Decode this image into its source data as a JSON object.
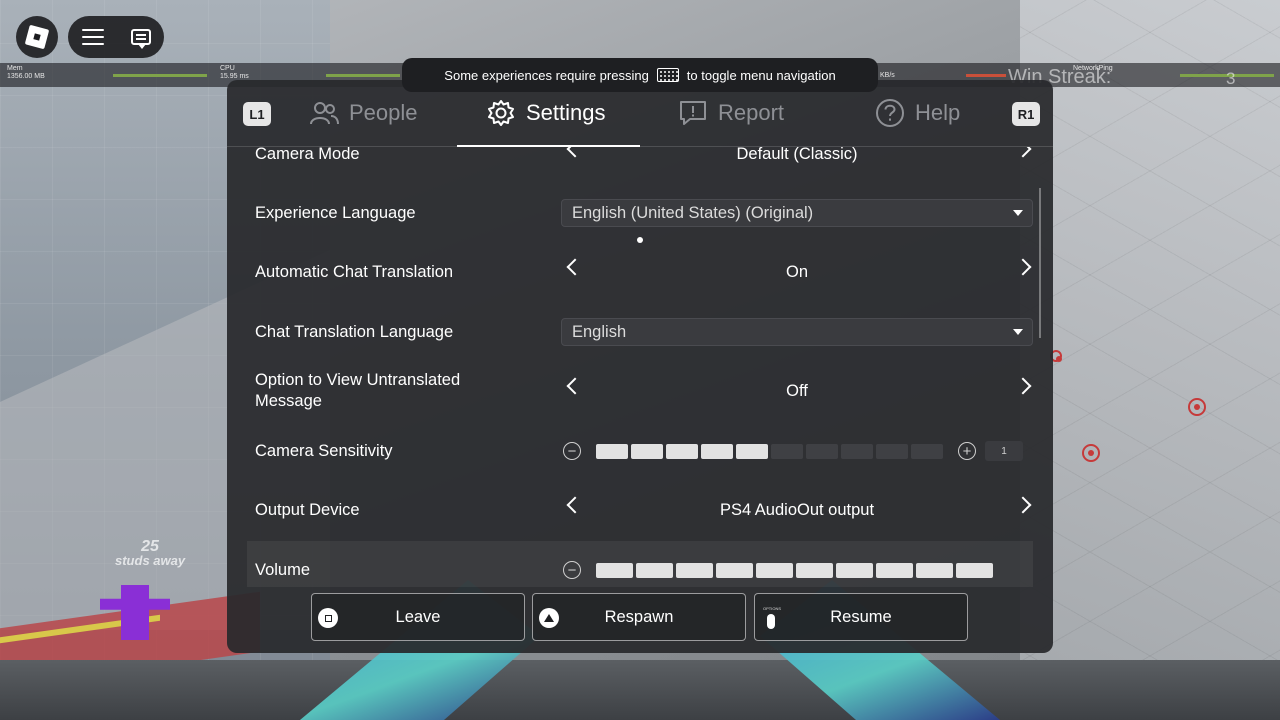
{
  "toast": {
    "text_before": "Some experiences require pressing",
    "text_after": "to toggle menu navigation"
  },
  "stats": {
    "mem_label": "Mem",
    "mem_value": "1356.00 MB",
    "cpu_label": "CPU",
    "cpu_value": "15.95 ms",
    "net_unit": "KB/s",
    "ping_label": "NetworkPing"
  },
  "game": {
    "win_streak_label": "Win Streak:",
    "win_streak_value": "3",
    "studs_number": "25",
    "studs_text": "studs away"
  },
  "shoulders": {
    "left": "L1",
    "right": "R1"
  },
  "tabs": [
    {
      "label": "People",
      "icon": "people-icon"
    },
    {
      "label": "Settings",
      "icon": "gear-icon"
    },
    {
      "label": "Report",
      "icon": "report-icon"
    },
    {
      "label": "Help",
      "icon": "help-icon"
    }
  ],
  "settings": {
    "camera_mode": {
      "label": "Camera Mode",
      "value": "Default (Classic)"
    },
    "experience_language": {
      "label": "Experience Language",
      "value": "English (United States) (Original)"
    },
    "auto_chat_translation": {
      "label": "Automatic Chat Translation",
      "value": "On"
    },
    "chat_translation_language": {
      "label": "Chat Translation Language",
      "value": "English"
    },
    "untranslated_message": {
      "label": "Option to View Untranslated Message",
      "value": "Off"
    },
    "camera_sensitivity": {
      "label": "Camera Sensitivity",
      "level": 5,
      "segments": 10,
      "value": "1"
    },
    "output_device": {
      "label": "Output Device",
      "value": "PS4 AudioOut output"
    },
    "volume": {
      "label": "Volume",
      "level": 10,
      "segments": 10
    }
  },
  "actions": {
    "leave": "Leave",
    "respawn": "Respawn",
    "resume": "Resume",
    "options_glyph_text": "OPTIONS"
  },
  "colors": {
    "panel": "#28292c",
    "segment_on": "#e2e2e2",
    "segment_off": "#3f4044",
    "accent_text": "#ffffff"
  }
}
